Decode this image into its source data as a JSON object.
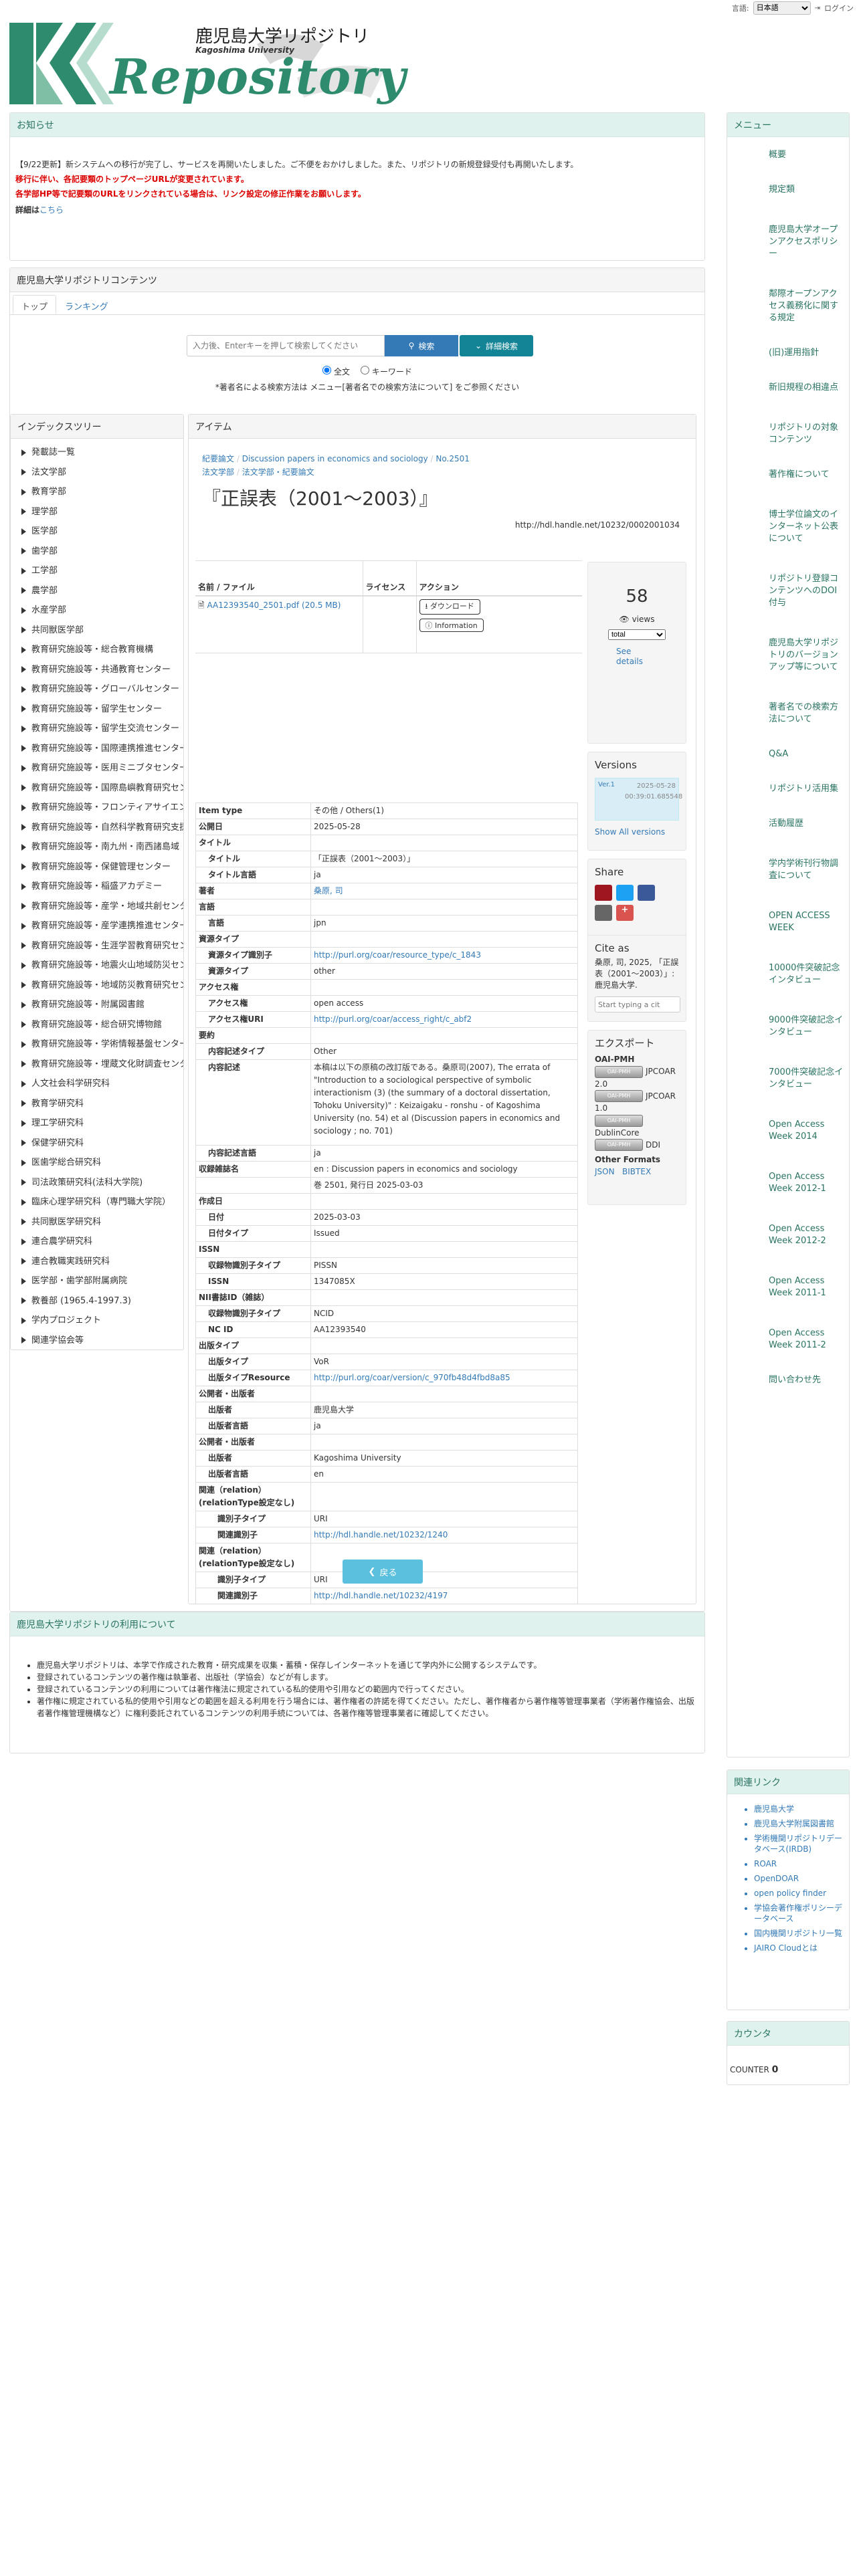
{
  "topbar": {
    "lang_label": "言語:",
    "lang_value": "日本語",
    "login": "ログイン"
  },
  "logo": {
    "title_jp": "鹿児島大学リポジトリ",
    "title_en": "Kagoshima University",
    "title_big": "Repository"
  },
  "notice": {
    "header": "お知らせ",
    "line1": "【9/22更新】新システムへの移行が完了し、サービスを再開いたしました。ご不便をおかけしました。また、リポジトリの新規登録受付も再開いたします。",
    "red1": "移行に伴い、各記要類のトップページURLが変更されています。",
    "red2": "各学部HP等で記要類のURLをリンクされている場合は、リンク設定の修正作業をお願いします。",
    "detail_label": "詳細は",
    "detail_link": "こちら"
  },
  "contents": {
    "header": "鹿児島大学リポジトリコンテンツ",
    "tabs": [
      "トップ",
      "ランキング"
    ],
    "search_placeholder": "入力後、Enterキーを押して検索してください",
    "search_button": "検索",
    "advanced_button": "詳細検索",
    "radio_full": "全文",
    "radio_keyword": "キーワード",
    "author_note": "*著者名による検索方法は メニュー[著者名での検索方法について] をご参照ください"
  },
  "index_tree": {
    "header": "インデックスツリー",
    "items": [
      "発載誌一覧",
      "法文学部",
      "教育学部",
      "理学部",
      "医学部",
      "歯学部",
      "工学部",
      "農学部",
      "水産学部",
      "共同獣医学部",
      "教育研究施設等・総合教育機構",
      "教育研究施設等・共通教育センター",
      "教育研究施設等・グローバルセンター",
      "教育研究施設等・留学生センター",
      "教育研究施設等・留学生交流センター",
      "教育研究施設等・国際連携推進センター",
      "教育研究施設等・医用ミニブタセンター",
      "教育研究施設等・国際島嶼教育研究センター",
      "教育研究施設等・フロンティアサイエンス",
      "教育研究施設等・自然科学教育研究支援",
      "教育研究施設等・南九州・南西諸島域",
      "教育研究施設等・保健管理センター",
      "教育研究施設等・稲盛アカデミー",
      "教育研究施設等・産学・地域共創センター",
      "教育研究施設等・産学連携推進センター",
      "教育研究施設等・生涯学習教育研究センター",
      "教育研究施設等・地震火山地域防災センター",
      "教育研究施設等・地域防災教育研究センター",
      "教育研究施設等・附属図書館",
      "教育研究施設等・総合研究博物館",
      "教育研究施設等・学術情報基盤センター",
      "教育研究施設等・埋蔵文化財調査センター",
      "人文社会科学研究科",
      "教育学研究科",
      "理工学研究科",
      "保健学研究科",
      "医歯学総合研究科",
      "司法政策研究科(法科大学院)",
      "臨床心理学研究科（専門職大学院）",
      "共同獣医学研究科",
      "連合農学研究科",
      "連合教職実践研究科",
      "医学部・歯学部附属病院",
      "教養部 (1965.4-1997.3)",
      "学内プロジェクト",
      "関連学協会等"
    ]
  },
  "item": {
    "header": "アイテム",
    "breadcrumb": [
      "紀要論文",
      "Discussion papers in economics and sociology",
      "No.2501"
    ],
    "breadcrumb2": [
      "法文学部",
      "法文学部・紀要論文"
    ],
    "title": "『正誤表（2001〜2003）』",
    "handle": "http://hdl.handle.net/10232/0002001034",
    "file_table": {
      "headers": [
        "名前 / ファイル",
        "ライセンス",
        "アクション"
      ],
      "filename": "AA12393540_2501.pdf (20.5 MB)",
      "download": "ダウンロード",
      "info": "Information"
    },
    "stats": {
      "views": "58",
      "views_label": "views",
      "period": "total",
      "see_details": "See details"
    },
    "versions": {
      "header": "Versions",
      "ver": "Ver.1",
      "date": "2025-05-28 00:39:01.685548",
      "show_all": "Show All versions"
    },
    "share": {
      "header": "Share"
    },
    "cite": {
      "header": "Cite as",
      "text": "桑原, 司, 2025, 「正誤表（2001〜2003）」: 鹿児島大学.",
      "placeholder": "Start typing a cit"
    },
    "export": {
      "header": "エクスポート",
      "oai": "OAI-PMH",
      "jpcoar2": "JPCOAR 2.0",
      "jpcoar1": "JPCOAR 1.0",
      "dublin": "DublinCore",
      "ddi": "DDI",
      "other": "Other Formats",
      "json": "JSON",
      "bibtex": "BIBTEX",
      "badge": "OAI-PMH"
    },
    "meta": [
      {
        "k": "Item type",
        "v": "その他 / Others(1)",
        "l": 0
      },
      {
        "k": "公開日",
        "v": "2025-05-28",
        "l": 0
      },
      {
        "k": "タイトル",
        "v": "",
        "l": 0
      },
      {
        "k": "タイトル",
        "v": "「正誤表（2001〜2003）」",
        "l": 1
      },
      {
        "k": "タイトル言語",
        "v": "ja",
        "l": 1
      },
      {
        "k": "著者",
        "v": "桑原, 司",
        "l": 0,
        "link": true
      },
      {
        "k": "言語",
        "v": "",
        "l": 0
      },
      {
        "k": "言語",
        "v": "jpn",
        "l": 1
      },
      {
        "k": "資源タイプ",
        "v": "",
        "l": 0
      },
      {
        "k": "資源タイプ識別子",
        "v": "http://purl.org/coar/resource_type/c_1843",
        "l": 1,
        "link": true
      },
      {
        "k": "資源タイプ",
        "v": "other",
        "l": 1
      },
      {
        "k": "アクセス権",
        "v": "",
        "l": 0
      },
      {
        "k": "アクセス権",
        "v": "open access",
        "l": 1
      },
      {
        "k": "アクセス権URI",
        "v": "http://purl.org/coar/access_right/c_abf2",
        "l": 1,
        "link": true
      },
      {
        "k": "要約",
        "v": "",
        "l": 0
      },
      {
        "k": "内容記述タイプ",
        "v": "Other",
        "l": 1
      },
      {
        "k": "内容記述",
        "v": "本稿は以下の原稿の改訂版である。桑原司(2007), The errata of \"Introduction to a sociological perspective of symbolic interactionism (3) (the summary of a doctoral dissertation, Tohoku University)\" : Keizaigaku - ronshu - of Kagoshima University (no. 54) et al (Discussion papers in economics and sociology ; no. 701)",
        "l": 1,
        "tall": true
      },
      {
        "k": "内容記述言語",
        "v": "ja",
        "l": 1
      },
      {
        "k": "収録雑誌名",
        "v": "en : Discussion papers in economics and sociology",
        "l": 0
      },
      {
        "k": "",
        "v": "巻 2501, 発行日 2025-03-03",
        "l": 0
      },
      {
        "k": "作成日",
        "v": "",
        "l": 0
      },
      {
        "k": "日付",
        "v": "2025-03-03",
        "l": 1
      },
      {
        "k": "日付タイプ",
        "v": "Issued",
        "l": 1
      },
      {
        "k": "ISSN",
        "v": "",
        "l": 0
      },
      {
        "k": "収録物識別子タイプ",
        "v": "PISSN",
        "l": 1
      },
      {
        "k": "ISSN",
        "v": "1347085X",
        "l": 1
      },
      {
        "k": "NII書誌ID（雑誌）",
        "v": "",
        "l": 0
      },
      {
        "k": "収録物識別子タイプ",
        "v": "NCID",
        "l": 1
      },
      {
        "k": "NC ID",
        "v": "AA12393540",
        "l": 1
      },
      {
        "k": "出版タイプ",
        "v": "",
        "l": 0
      },
      {
        "k": "出版タイプ",
        "v": "VoR",
        "l": 1
      },
      {
        "k": "出版タイプResource",
        "v": "http://purl.org/coar/version/c_970fb48d4fbd8a85",
        "l": 1,
        "link": true
      },
      {
        "k": "公開者・出版者",
        "v": "",
        "l": 0
      },
      {
        "k": "出版者",
        "v": "鹿児島大学",
        "l": 1
      },
      {
        "k": "出版者言語",
        "v": "ja",
        "l": 1
      },
      {
        "k": "公開者・出版者",
        "v": "",
        "l": 0
      },
      {
        "k": "出版者",
        "v": "Kagoshima University",
        "l": 1
      },
      {
        "k": "出版者言語",
        "v": "en",
        "l": 1
      },
      {
        "k": "関連（relation）(relationType設定なし)",
        "v": "",
        "l": 0,
        "two": true
      },
      {
        "k": "識別子タイプ",
        "v": "URI",
        "l": 2
      },
      {
        "k": "関連識別子",
        "v": "http://hdl.handle.net/10232/1240",
        "l": 2,
        "link": true
      },
      {
        "k": "関連（relation）(relationType設定なし)",
        "v": "",
        "l": 0,
        "two": true
      },
      {
        "k": "識別子タイプ",
        "v": "URI",
        "l": 2
      },
      {
        "k": "関連識別子",
        "v": "http://hdl.handle.net/10232/4197",
        "l": 2,
        "link": true
      }
    ],
    "back": "戻る"
  },
  "usage": {
    "header": "鹿児島大学リポジトリの利用について",
    "items": [
      "鹿児島大学リポジトリは、本学で作成された教育・研究成果を収集・蓄積・保存しインターネットを通じて学内外に公開するシステムです。",
      "登録されているコンテンツの著作権は執筆者、出版社（学協会）などが有します。",
      "登録されているコンテンツの利用については著作権法に規定されている私的使用や引用などの範囲内で行ってください。",
      "著作権に規定されている私的使用や引用などの範囲を超える利用を行う場合には、著作権者の許諾を得てください。ただし、著作権者から著作権等管理事業者（学術著作権協会、出版者著作権管理機構など）に権利委託されているコンテンツの利用手続については、各著作権等管理事業者に確認してください。"
    ]
  },
  "menu": {
    "header": "メニュー",
    "items": [
      {
        "t": "概要",
        "h": 1
      },
      {
        "t": "規定類",
        "h": 1
      },
      {
        "t": "鹿児島大学オープンアクセスポリシー",
        "h": 6
      },
      {
        "t": "鄰際オープンアクセス義務化に関する規定",
        "h": 5
      },
      {
        "t": "(旧)運用指針",
        "h": 2
      },
      {
        "t": "新旧規程の相違点",
        "h": 2
      },
      {
        "t": "リポジトリの対象コンテンツ",
        "h": 4
      },
      {
        "t": "著作権について",
        "h": 2
      },
      {
        "t": "博士学位論文のインターネット公表について",
        "h": 5
      },
      {
        "t": "リポジトリ登録コンテンツへのDOI付与",
        "h": 5
      },
      {
        "t": "鹿児島大学リポジトリのバージョンアップ等について",
        "h": 6
      },
      {
        "t": "著者名での検索方法について",
        "h": 4
      },
      {
        "t": "Q&A",
        "h": 1
      },
      {
        "t": "リポジトリ活用集",
        "h": 2
      },
      {
        "t": "活動履歴",
        "h": 1
      },
      {
        "t": "学内学術刊行物調査について",
        "h": 4
      },
      {
        "t": "OPEN ACCESS WEEK",
        "h": 3
      },
      {
        "t": "10000件突破記念インタビュー",
        "h": 4
      },
      {
        "t": "9000件突破記念インタビュー",
        "h": 4
      },
      {
        "t": "7000件突破記念インタビュー",
        "h": 4
      },
      {
        "t": "Open Access Week 2014",
        "h": 4
      },
      {
        "t": "Open Access Week 2012-1",
        "h": 4
      },
      {
        "t": "Open Access Week 2012-2",
        "h": 4
      },
      {
        "t": "Open Access Week 2011-1",
        "h": 4
      },
      {
        "t": "Open Access Week 2011-2",
        "h": 4
      },
      {
        "t": "問い合わせ先",
        "h": 2
      }
    ]
  },
  "links": {
    "header": "関連リンク",
    "items": [
      "鹿児島大学",
      "鹿児島大学附属図書館",
      "学術機関リポジトリデータベース(IRDB)",
      "ROAR",
      "OpenDOAR",
      "open policy finder",
      "学協会著作権ポリシーデータベース",
      "国内機関リポジトリ一覧",
      "JAIRO Cloudとは"
    ]
  },
  "counter": {
    "header": "カウンタ",
    "label": "COUNTER",
    "value": "0"
  }
}
